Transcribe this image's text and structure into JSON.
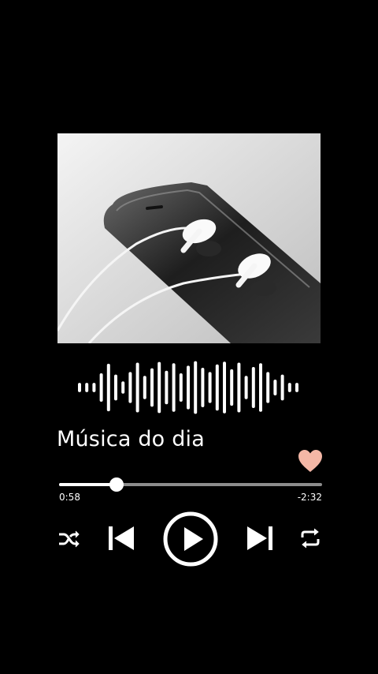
{
  "player": {
    "track_title": "Música do dia",
    "progress_fraction": 0.22,
    "time_elapsed": "0:58",
    "time_remaining": "-2:32",
    "favorite": true
  },
  "artwork": {
    "subject": "smartphone with white earphones"
  },
  "waveform": {
    "levels": [
      0.12,
      0.12,
      0.12,
      0.5,
      0.88,
      0.45,
      0.18,
      0.55,
      0.92,
      0.4,
      0.7,
      0.95,
      0.6,
      0.9,
      0.5,
      0.8,
      0.98,
      0.72,
      0.55,
      0.85,
      0.96,
      0.66,
      0.92,
      0.4,
      0.75,
      0.9,
      0.55,
      0.25,
      0.45,
      0.12,
      0.12
    ]
  },
  "icons": {
    "shuffle": "shuffle-icon",
    "previous": "skip-previous-icon",
    "play": "play-icon",
    "next": "skip-next-icon",
    "repeat": "repeat-icon",
    "favorite": "heart-icon"
  },
  "colors": {
    "background": "#000000",
    "heart": "#f4b7a6",
    "track": "#8c8c8c",
    "foreground": "#ffffff"
  }
}
